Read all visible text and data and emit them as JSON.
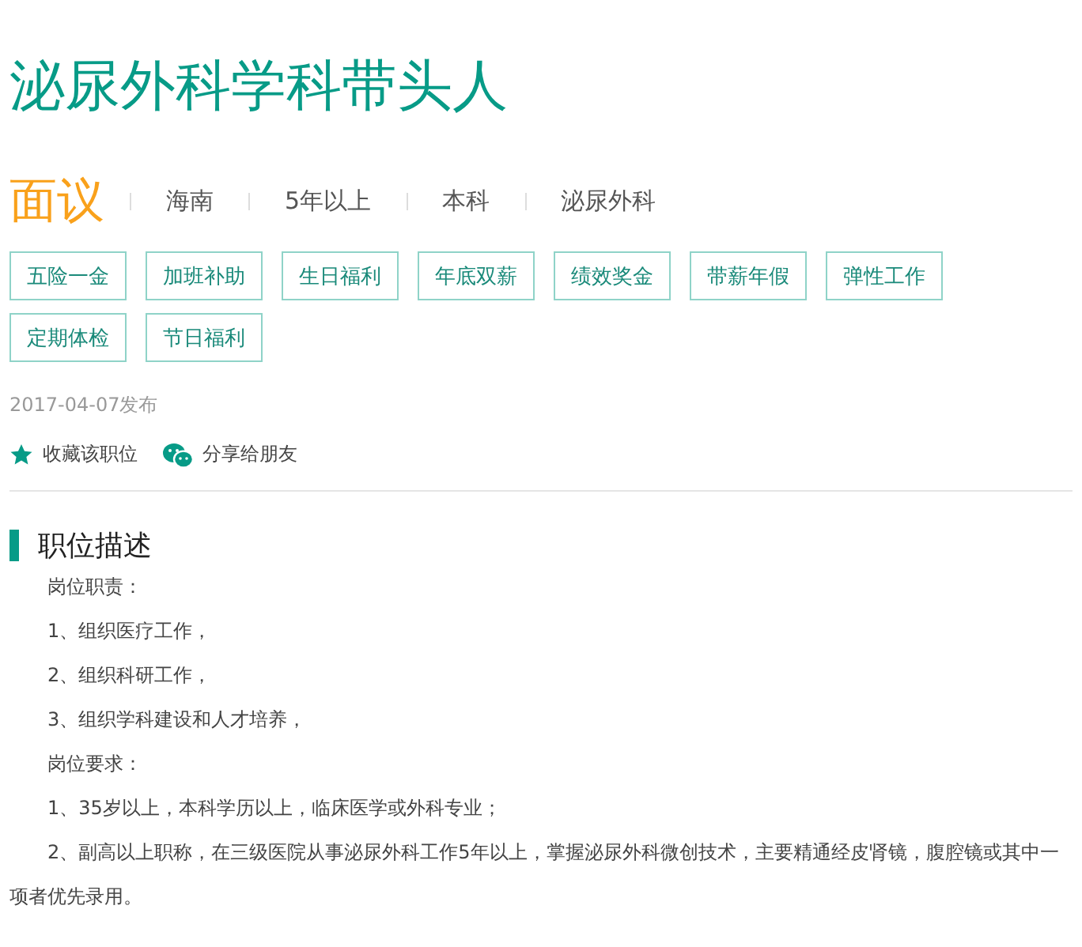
{
  "title": "泌尿外科学科带头人",
  "salary": "面议",
  "meta": [
    "海南",
    "5年以上",
    "本科",
    "泌尿外科"
  ],
  "tags": [
    "五险一金",
    "加班补助",
    "生日福利",
    "年底双薪",
    "绩效奖金",
    "带薪年假",
    "弹性工作",
    "定期体检",
    "节日福利"
  ],
  "published": "2017-04-07发布",
  "actions": [
    {
      "kind": "star",
      "label": "收藏该职位"
    },
    {
      "kind": "wechat",
      "label": "分享给朋友"
    }
  ],
  "section_title": "职位描述",
  "paragraphs": [
    "岗位职责：",
    "1、组织医疗工作，",
    "2、组织科研工作，",
    "3、组织学科建设和人才培养，",
    "岗位要求：",
    "1、35岁以上，本科学历以上，临床医学或外科专业；",
    "2、副高以上职称，在三级医院从事泌尿外科工作5年以上，掌握泌尿外科微创技术，主要精通经皮肾镜，腹腔镜或其中一项者优先录用。"
  ]
}
